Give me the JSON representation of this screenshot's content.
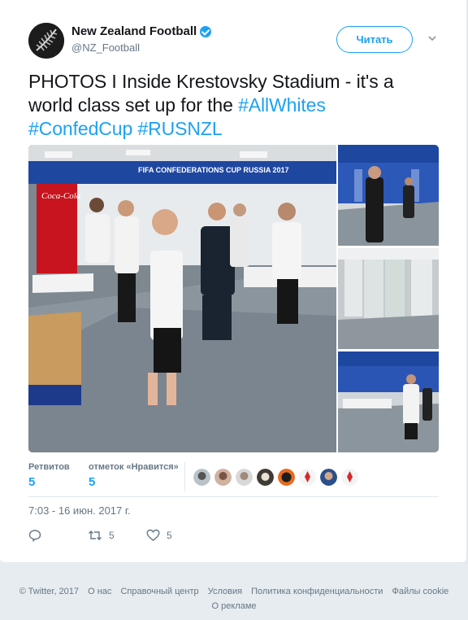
{
  "account": {
    "name": "New Zealand Football",
    "handle": "@NZ_Football",
    "follow_label": "Читать"
  },
  "tweet": {
    "text_plain": "PHOTOS I Inside Krestovsky Stadium - it's a world class set up for the",
    "hashtags": [
      "#AllWhites",
      "#ConfedCup",
      "#RUSNZL"
    ],
    "photo_banner": "FIFA CONFEDERATIONS CUP RUSSIA 2017",
    "fridge_brand": "Coca-Cola"
  },
  "stats": {
    "retweets_label": "Ретвитов",
    "retweets_value": "5",
    "likes_label": "отметок «Нравится»",
    "likes_value": "5"
  },
  "timestamp": "7:03 - 16 июн. 2017 г.",
  "actions": {
    "reply_count": "",
    "retweet_count": "5",
    "like_count": "5"
  },
  "footer": {
    "copyright": "© Twitter, 2017",
    "links": [
      "О нас",
      "Справочный центр",
      "Условия",
      "Политика конфиденциальности",
      "Файлы cookie"
    ],
    "ads": "О рекламе"
  },
  "colors": {
    "accent": "#1da1f2",
    "text": "#14171a",
    "muted": "#657786",
    "background": "#e6ecf0"
  }
}
